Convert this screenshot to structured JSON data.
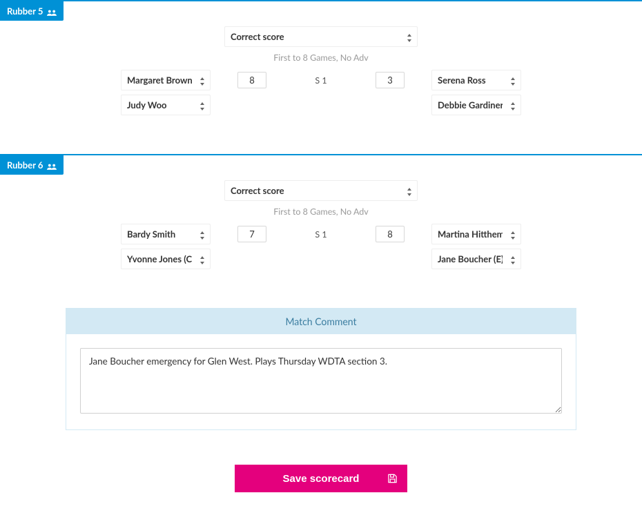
{
  "rubbers": [
    {
      "label": "Rubber 5",
      "score_type": "Correct score",
      "format": "First to 8 Games, No Adv",
      "home_players": [
        "Margaret Brown",
        "Judy Woo"
      ],
      "away_players": [
        "Serena Ross",
        "Debbie Gardiner (C)"
      ],
      "set_label": "S 1",
      "score_home": "8",
      "score_away": "3"
    },
    {
      "label": "Rubber 6",
      "score_type": "Correct score",
      "format": "First to 8 Games, No Adv",
      "home_players": [
        "Bardy Smith",
        "Yvonne Jones (C)"
      ],
      "away_players": [
        "Martina Hitthemova",
        "Jane Boucher (E)"
      ],
      "set_label": "S 1",
      "score_home": "7",
      "score_away": "8"
    }
  ],
  "comment": {
    "title": "Match Comment",
    "text": "Jane Boucher emergency for Glen West. Plays Thursday WDTA section 3."
  },
  "save_label": "Save scorecard"
}
